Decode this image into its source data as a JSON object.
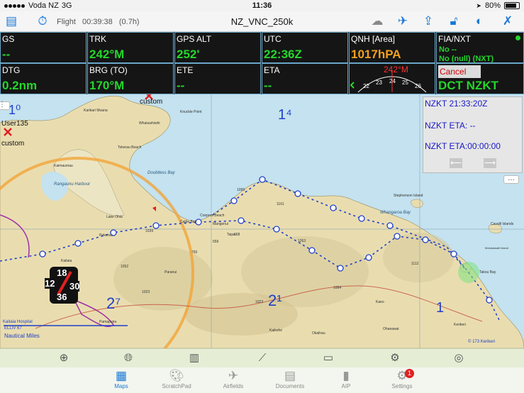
{
  "status": {
    "carrier": "Voda NZ",
    "network": "3G",
    "time": "11:36",
    "battery": "80%"
  },
  "toolbar": {
    "flight_label": "Flight",
    "flight_time": "00:39:38",
    "flight_duration": "(0.7h)",
    "chart_title": "NZ_VNC_250k"
  },
  "instruments": {
    "gs": {
      "label": "GS",
      "value": "--"
    },
    "trk": {
      "label": "TRK",
      "value": "242°M"
    },
    "gps_alt": {
      "label": "GPS ALT",
      "value": "252'"
    },
    "utc": {
      "label": "UTC",
      "value": "22:36Z"
    },
    "qnh": {
      "label": "QNH [Area]",
      "value": "1017hPA"
    },
    "fia": {
      "label": "FIA/NXT",
      "line1": "No  --",
      "line2": "No  (null) (NXT)"
    },
    "dtg": {
      "label": "DTG",
      "value": "0.2nm"
    },
    "brg": {
      "label": "BRG (TO)",
      "value": "170°M"
    },
    "ete": {
      "label": "ETE",
      "value": "--"
    },
    "eta": {
      "label": "ETA",
      "value": "--"
    },
    "compass": {
      "heading": "242°M",
      "ticks": [
        "22",
        "23",
        "24",
        "25",
        "26"
      ]
    },
    "direct": {
      "cancel_label": "Cancel",
      "value": "DCT NZKT"
    }
  },
  "eta_popup": {
    "line1": "NZKT 21:33:20Z",
    "line2": "NZKT ETA: --",
    "line3": "NZKT ETA:00:00:00"
  },
  "map": {
    "grid_labels": [
      "1⁰",
      "1⁴",
      "2¹",
      "2⁷",
      "1"
    ],
    "place_labels": [
      "Karikari Moana",
      "Tokerau Beach",
      "Knuckle Point",
      "Whatuwhiwhi",
      "Kaimaumau",
      "Rangaunu Harbour",
      "Doubtless Bay",
      "Lake Ohia",
      "Pekerau",
      "Coopers Beach",
      "Cable Bay",
      "Mangonui",
      "Kaitaia",
      "Whangaroa Bay",
      "Stephenson Island",
      "Cavalli Islands",
      "Motukawaiti Island",
      "Takou Bay",
      "Kerikeri",
      "Ohaeawai",
      "Okaihau",
      "Kaeo",
      "Kaikohe",
      "Taipa",
      "Paranui",
      "Pamapuria"
    ],
    "waypoint_labels": [
      "custom",
      "User135",
      "custom"
    ],
    "airport_labels": [
      "Kaitaia Hospital",
      "ELLIV 67"
    ],
    "elevations": [
      "1099",
      "1161",
      "1263",
      "1023",
      "1084",
      "1112",
      "1039",
      "1052",
      "1023",
      "668",
      "659",
      "750"
    ],
    "scale_label": "Nautical Miles",
    "copyright": "© 173 Kerikeri"
  },
  "wind": [
    "18",
    "12",
    "30",
    "36"
  ],
  "toolrow": [
    "crosshair-icon",
    "globe-icon",
    "map-icon",
    "route-icon",
    "profile-icon",
    "gear-icon",
    "target-icon"
  ],
  "tabs": [
    {
      "label": "Maps"
    },
    {
      "label": "ScratchPad"
    },
    {
      "label": "Airfields"
    },
    {
      "label": "Documents"
    },
    {
      "label": "AIP"
    },
    {
      "label": "Settings",
      "badge": "1"
    }
  ],
  "colors": {
    "accent": "#1a78d6",
    "panel_bg": "#151515",
    "value_green": "#24d62c",
    "qnh_orange": "#f0a020",
    "route_blue": "#2040c8",
    "range_ring": "#f3a030",
    "sea": "#c4e2ef",
    "land": "#e8dcae"
  }
}
